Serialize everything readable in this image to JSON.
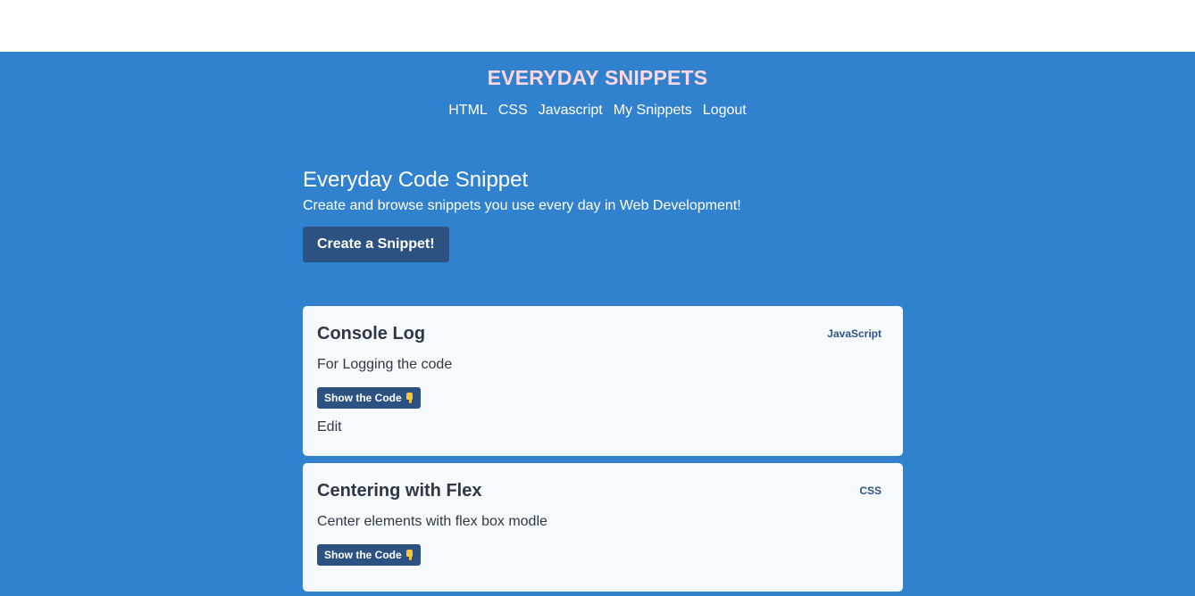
{
  "header": {
    "site_title": "EVERYDAY SNIPPETS",
    "nav": [
      "HTML",
      "CSS",
      "Javascript",
      "My Snippets",
      "Logout"
    ]
  },
  "hero": {
    "title": "Everyday Code Snippet",
    "subtitle": "Create and browse snippets you use every day in Web Development!",
    "create_button": "Create a Snippet!"
  },
  "snippets": [
    {
      "title": "Console Log",
      "language": "JavaScript",
      "description": "For Logging the code",
      "show_code_label": "Show the Code",
      "edit_label": "Edit"
    },
    {
      "title": "Centering with Flex",
      "language": "CSS",
      "description": "Center elements with flex box modle",
      "show_code_label": "Show the Code"
    }
  ],
  "icons": {
    "show_code": "pointing-down-hand-icon"
  },
  "colors": {
    "background": "#3182ce",
    "title": "#fed7e2",
    "button": "#2c5282",
    "card": "#f7fafc"
  }
}
